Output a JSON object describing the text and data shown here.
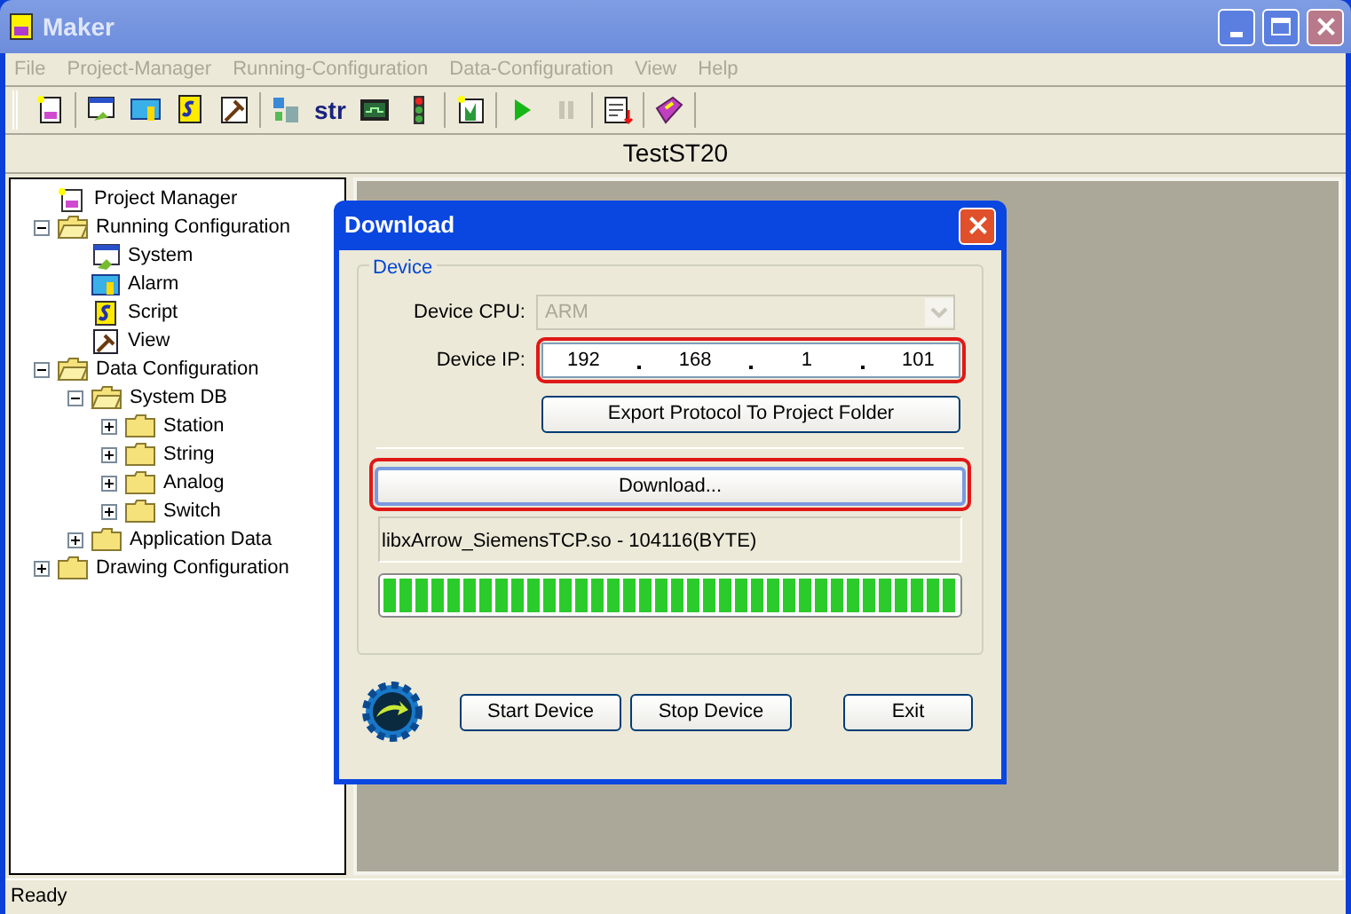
{
  "window": {
    "title": "Maker"
  },
  "menu": [
    {
      "label": "File",
      "disabled": true
    },
    {
      "label": "Project-Manager",
      "disabled": true
    },
    {
      "label": "Running-Configuration",
      "disabled": true
    },
    {
      "label": "Data-Configuration",
      "disabled": true
    },
    {
      "label": "View",
      "disabled": true
    },
    {
      "label": "Help",
      "disabled": true
    }
  ],
  "toolbar": {
    "str_label": "str",
    "pause_disabled": true
  },
  "project_name": "TestST20",
  "tree": [
    {
      "label": "Project Manager",
      "kind": "project"
    },
    {
      "label": "Running Configuration",
      "kind": "folder",
      "expanded": true,
      "children": [
        {
          "label": "System",
          "kind": "system"
        },
        {
          "label": "Alarm",
          "kind": "alarm"
        },
        {
          "label": "Script",
          "kind": "script"
        },
        {
          "label": "View",
          "kind": "view"
        }
      ]
    },
    {
      "label": "Data Configuration",
      "kind": "folder",
      "expanded": true,
      "children": [
        {
          "label": "System DB",
          "kind": "folder",
          "expanded": true,
          "children": [
            {
              "label": "Station",
              "kind": "folder",
              "expanded": false
            },
            {
              "label": "String",
              "kind": "folder",
              "expanded": false
            },
            {
              "label": "Analog",
              "kind": "folder",
              "expanded": false
            },
            {
              "label": "Switch",
              "kind": "folder",
              "expanded": false
            }
          ]
        },
        {
          "label": "Application Data",
          "kind": "folder",
          "expanded": false
        }
      ]
    },
    {
      "label": "Drawing Configuration",
      "kind": "folder",
      "expanded": false
    }
  ],
  "dialog": {
    "title": "Download",
    "group_label": "Device",
    "cpu_label": "Device CPU:",
    "cpu_value": "ARM",
    "cpu_disabled": true,
    "ip_label": "Device IP:",
    "ip_parts": [
      "192",
      "168",
      "1",
      "101"
    ],
    "export_button": "Export Protocol To Project Folder",
    "download_button": "Download...",
    "file_info": "libxArrow_SiemensTCP.so - 104116(BYTE)",
    "progress": {
      "level": 1
    },
    "buttons": [
      "Start Device",
      "Stop Device",
      "Exit"
    ]
  },
  "status_bar": "Ready"
}
